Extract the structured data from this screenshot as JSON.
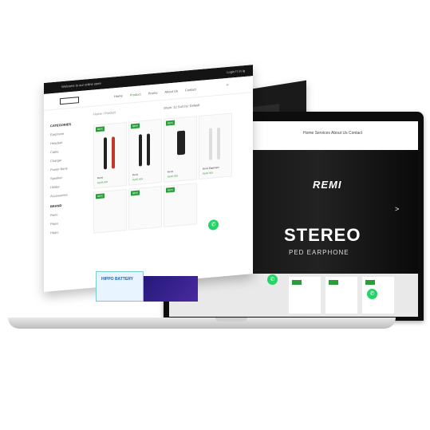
{
  "laptop": {
    "hero": {
      "brand": "REMI",
      "title": "STEREO",
      "subtitle": "PED EARPHONE",
      "arrow": ">"
    },
    "nav_menu": "Home  Services  About Us  Contact"
  },
  "front_page": {
    "topbar_left": "Welcome to our online store",
    "topbar_right": "Login  f  t  in  ig",
    "nav": [
      {
        "label": "Home"
      },
      {
        "label": "Product"
      },
      {
        "label": "Promo"
      },
      {
        "label": "About Us"
      },
      {
        "label": "Contact"
      }
    ],
    "breadcrumb": "Home / Product",
    "sort": "Show: 12   Sort by: Default",
    "categories_title": "CATEGORIES",
    "categories": [
      "Earphone",
      "Headset",
      "Cable",
      "Charger",
      "Power Bank",
      "Speaker",
      "Holder",
      "Accessories"
    ],
    "brand_title": "BRAND",
    "brands": [
      "Remi",
      "Pisen",
      "Hippo"
    ],
    "products": [
      {
        "badge": "NEW",
        "name": "Remi",
        "price": "Rp49.000"
      },
      {
        "badge": "NEW",
        "name": "Remi",
        "price": "Rp55.000"
      },
      {
        "badge": "NEW",
        "name": "Remi",
        "price": "Rp65.000"
      },
      {
        "badge": "",
        "name": "Remi Earphone",
        "price": "Rp45.000"
      },
      {
        "badge": "NEW",
        "name": "",
        "price": ""
      },
      {
        "badge": "NEW",
        "name": "",
        "price": ""
      },
      {
        "badge": "NEW",
        "name": "",
        "price": ""
      }
    ],
    "banner_text": "HIPPO BATTERY"
  },
  "whatsapp_icon": "whatsapp-icon",
  "colors": {
    "accent": "#2a9d3a",
    "whatsapp": "#25d366",
    "dark": "#141414"
  }
}
